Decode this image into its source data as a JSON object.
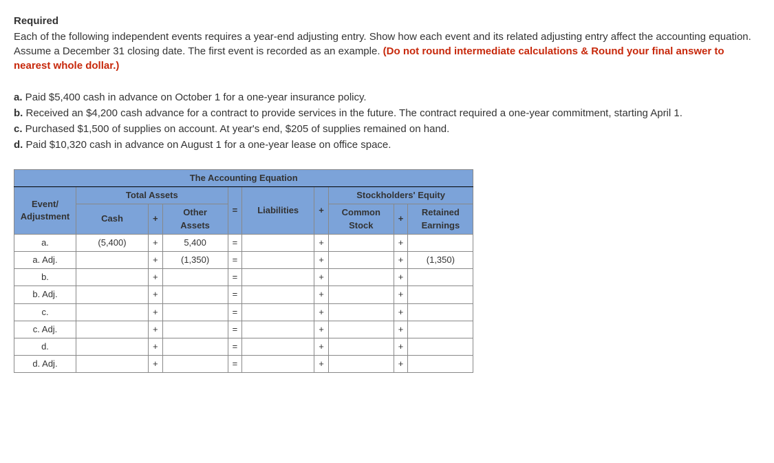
{
  "required_label": "Required",
  "instructions_p1": "Each of the following independent events requires a year-end adjusting entry. Show how each event and its related adjusting entry affect the accounting equation. Assume a December 31 closing date. The first event is recorded as an example.",
  "instructions_red": " (Do not round intermediate calculations & Round your final answer to nearest whole dollar.)",
  "events": {
    "a": {
      "letter": "a.",
      "text": " Paid $5,400 cash in advance on October 1 for a one-year insurance policy."
    },
    "b": {
      "letter": "b.",
      "text": " Received an $4,200 cash advance for a contract to provide services in the future. The contract required a one-year commitment, starting April 1."
    },
    "c": {
      "letter": "c.",
      "text": " Purchased $1,500 of supplies on account. At year's end, $205 of supplies remained on hand."
    },
    "d": {
      "letter": "d.",
      "text": " Paid $10,320 cash in advance on August 1 for a one-year lease on office space."
    }
  },
  "table": {
    "title": "The Accounting Equation",
    "event_header": "Event/\nAdjustment",
    "total_assets": "Total Assets",
    "cash": "Cash",
    "other_assets": "Other\nAssets",
    "liabilities": "Liabilities",
    "stockholders_equity": "Stockholders' Equity",
    "common_stock": "Common\nStock",
    "retained_earnings": "Retained\nEarnings",
    "plus": "+",
    "equals": "=",
    "rows": [
      {
        "label": "a.",
        "cash": "(5,400)",
        "other": "5,400",
        "liab": "",
        "cs": "",
        "re": ""
      },
      {
        "label": "a. Adj.",
        "cash": "",
        "other": "(1,350)",
        "liab": "",
        "cs": "",
        "re": "(1,350)"
      },
      {
        "label": "b.",
        "cash": "",
        "other": "",
        "liab": "",
        "cs": "",
        "re": ""
      },
      {
        "label": "b. Adj.",
        "cash": "",
        "other": "",
        "liab": "",
        "cs": "",
        "re": ""
      },
      {
        "label": "c.",
        "cash": "",
        "other": "",
        "liab": "",
        "cs": "",
        "re": ""
      },
      {
        "label": "c. Adj.",
        "cash": "",
        "other": "",
        "liab": "",
        "cs": "",
        "re": ""
      },
      {
        "label": "d.",
        "cash": "",
        "other": "",
        "liab": "",
        "cs": "",
        "re": ""
      },
      {
        "label": "d. Adj.",
        "cash": "",
        "other": "",
        "liab": "",
        "cs": "",
        "re": ""
      }
    ]
  }
}
